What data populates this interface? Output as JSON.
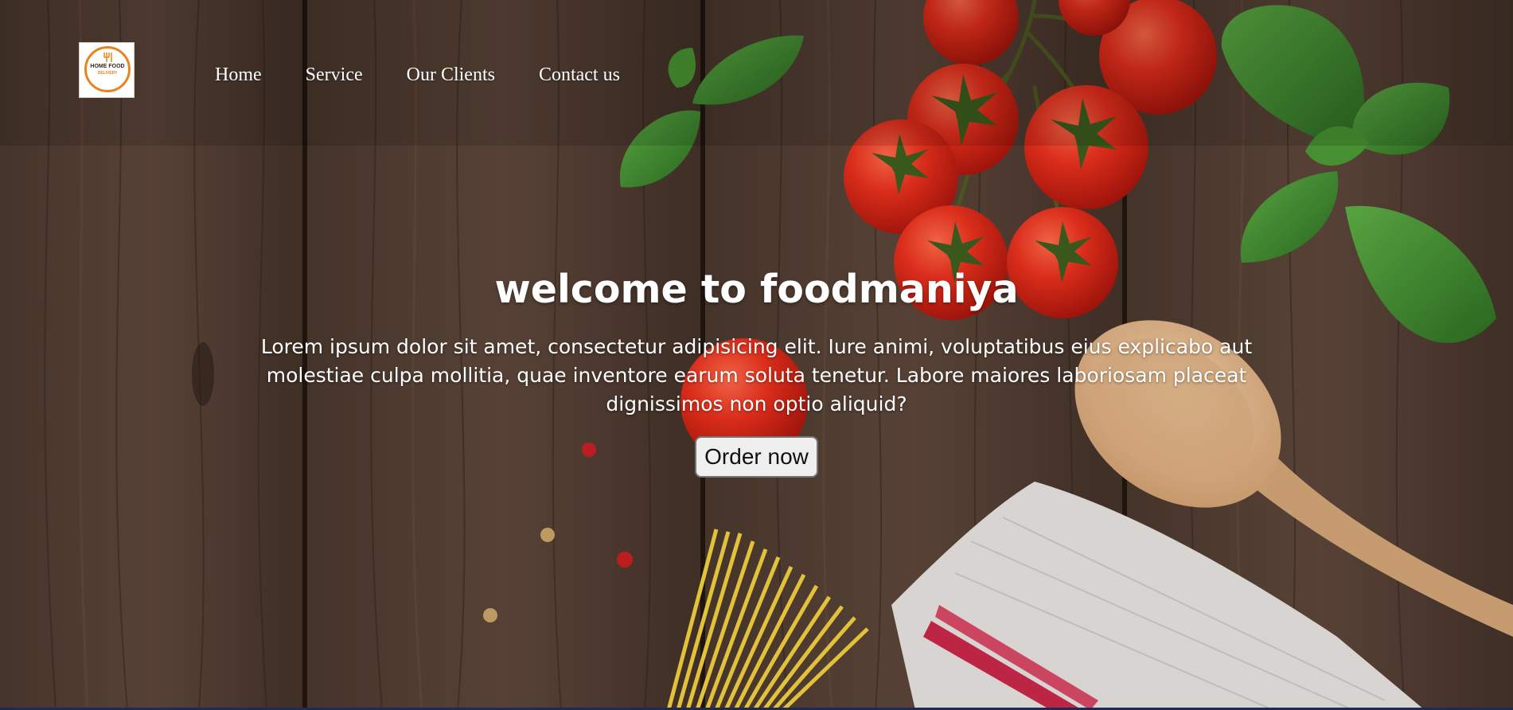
{
  "header": {
    "logo": {
      "icon": "home-food-logo",
      "line1": "HOME FOOD",
      "line2": "DELIVERY"
    },
    "nav": [
      {
        "label": "Home"
      },
      {
        "label": "Service"
      },
      {
        "label": "Our Clients"
      },
      {
        "label": "Contact us"
      }
    ]
  },
  "hero": {
    "title": "welcome to foodmaniya",
    "text": "Lorem ipsum dolor sit amet, consectetur adipisicing elit. Iure animi, voluptatibus eius explicabo aut molestiae culpa mollitia, quae inventore earum soluta tenetur. Labore maiores laboriosam placeat dignissimos non optio aliquid?",
    "button_label": "Order now"
  },
  "background": {
    "description_icon": "food-table-photo",
    "colors": {
      "wood_dark": "#3a2a22",
      "wood_mid": "#5a4234",
      "tomato": "#e5281a",
      "basil": "#3f8f2e",
      "spoon": "#e6b88a",
      "pasta": "#f2d24a",
      "cloth": "#e8e4e2",
      "stripe": "#c82a4a"
    }
  }
}
